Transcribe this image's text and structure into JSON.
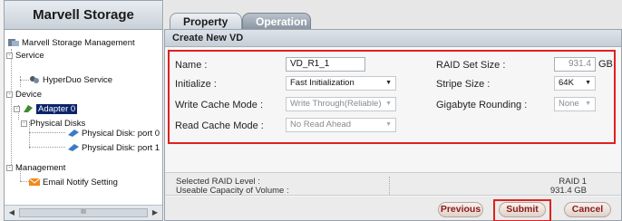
{
  "sidebar": {
    "title": "Marvell Storage",
    "tree": {
      "root": "Marvell Storage Management",
      "service": "Service",
      "hyperduo": "HyperDuo Service",
      "device": "Device",
      "adapter": "Adapter 0",
      "physical_disks": "Physical Disks",
      "disk1": "Physical Disk: port 0",
      "disk2": "Physical Disk: port 1",
      "management": "Management",
      "email_notify": "Email Notify Setting"
    },
    "scroll_thumb": "III"
  },
  "tabs": [
    {
      "label": "Property",
      "active": true
    },
    {
      "label": "Operation",
      "active": false
    }
  ],
  "panel": {
    "header": "Create New VD",
    "form": {
      "name_label": "Name :",
      "name_value": "VD_R1_1",
      "initialize_label": "Initialize :",
      "initialize_value": "Fast Initialization",
      "write_cache_label": "Write Cache Mode :",
      "write_cache_value": "Write Through(Reliable)",
      "read_cache_label": "Read Cache Mode :",
      "read_cache_value": "No Read Ahead",
      "raid_set_size_label": "RAID Set Size :",
      "raid_set_size_value": "931.4",
      "raid_set_size_unit": "GB",
      "stripe_size_label": "Stripe Size :",
      "stripe_size_value": "64K",
      "gigabyte_rounding_label": "Gigabyte Rounding :",
      "gigabyte_rounding_value": "None"
    },
    "summary": {
      "raid_level_label": "Selected RAID Level :",
      "capacity_label": "Useable Capacity of Volume :",
      "raid_level_value": "RAID 1",
      "capacity_value": "931.4 GB"
    },
    "buttons": {
      "previous": "Previous",
      "submit": "Submit",
      "cancel": "Cancel"
    }
  },
  "colors": {
    "highlight_border": "#e02020",
    "selection": "#0a246a",
    "button_text": "#8b1a1a"
  }
}
